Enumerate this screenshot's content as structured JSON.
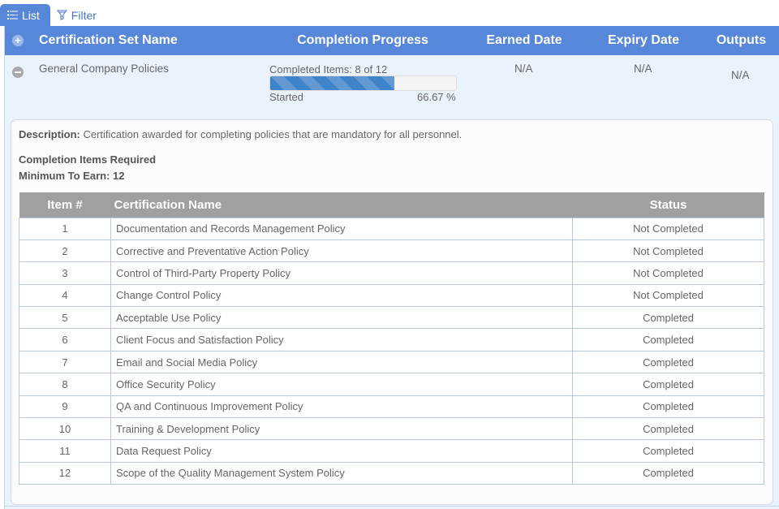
{
  "tabs": [
    {
      "label": "List",
      "icon": "list-icon",
      "active": true
    },
    {
      "label": "Filter",
      "icon": "filter-icon",
      "active": false
    }
  ],
  "colors": {
    "header_bg": "#5787d9",
    "row_bg": "#eaf2fd",
    "progress_fill": "#3f83c9",
    "table_header_bg": "#a0a0a2",
    "not_completed": "#e0182d",
    "completed": "#2d8a2d"
  },
  "grid": {
    "columns": {
      "name": "Certification Set Name",
      "progress": "Completion Progress",
      "earned": "Earned Date",
      "expiry": "Expiry Date",
      "outputs": "Outputs"
    },
    "row": {
      "name": "General Company Policies",
      "progress_label": "Completed Items: 8 of 12",
      "progress_percent": 66.67,
      "progress_status": "Started",
      "progress_pct_text": "66.67 %",
      "earned": "N/A",
      "expiry": "N/A",
      "outputs": "N/A"
    }
  },
  "detail": {
    "description_label": "Description:",
    "description": "Certification awarded for completing policies that are mandatory for all personnel.",
    "required_heading": "Completion Items Required",
    "minimum_label": "Minimum To Earn: 12",
    "table": {
      "headers": {
        "num": "Item #",
        "name": "Certification Name",
        "status": "Status"
      },
      "rows": [
        {
          "num": "1",
          "name": "Documentation and Records Management Policy",
          "status": "Not Completed",
          "done": false
        },
        {
          "num": "2",
          "name": "Corrective and Preventative Action Policy",
          "status": "Not Completed",
          "done": false
        },
        {
          "num": "3",
          "name": "Control of Third-Party Property Policy",
          "status": "Not Completed",
          "done": false
        },
        {
          "num": "4",
          "name": "Change Control Policy",
          "status": "Not Completed",
          "done": false
        },
        {
          "num": "5",
          "name": "Acceptable Use Policy",
          "status": "Completed",
          "done": true
        },
        {
          "num": "6",
          "name": "Client Focus and Satisfaction Policy",
          "status": "Completed",
          "done": true
        },
        {
          "num": "7",
          "name": "Email and Social Media Policy",
          "status": "Completed",
          "done": true
        },
        {
          "num": "8",
          "name": "Office Security Policy",
          "status": "Completed",
          "done": true
        },
        {
          "num": "9",
          "name": "QA and Continuous Improvement Policy",
          "status": "Completed",
          "done": true
        },
        {
          "num": "10",
          "name": "Training & Development Policy",
          "status": "Completed",
          "done": true
        },
        {
          "num": "11",
          "name": "Data Request Policy",
          "status": "Completed",
          "done": true
        },
        {
          "num": "12",
          "name": "Scope of the Quality Management System Policy",
          "status": "Completed",
          "done": true
        }
      ]
    }
  }
}
